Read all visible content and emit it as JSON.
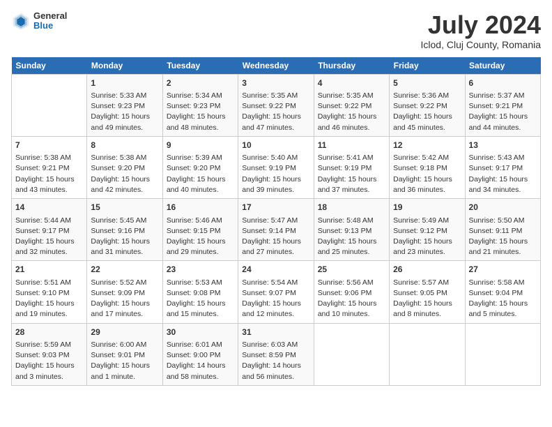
{
  "header": {
    "logo": {
      "general": "General",
      "blue": "Blue"
    },
    "title": "July 2024",
    "location": "Iclod, Cluj County, Romania"
  },
  "calendar": {
    "weekdays": [
      "Sunday",
      "Monday",
      "Tuesday",
      "Wednesday",
      "Thursday",
      "Friday",
      "Saturday"
    ],
    "weeks": [
      [
        {
          "day": "",
          "info": ""
        },
        {
          "day": "1",
          "info": "Sunrise: 5:33 AM\nSunset: 9:23 PM\nDaylight: 15 hours\nand 49 minutes."
        },
        {
          "day": "2",
          "info": "Sunrise: 5:34 AM\nSunset: 9:23 PM\nDaylight: 15 hours\nand 48 minutes."
        },
        {
          "day": "3",
          "info": "Sunrise: 5:35 AM\nSunset: 9:22 PM\nDaylight: 15 hours\nand 47 minutes."
        },
        {
          "day": "4",
          "info": "Sunrise: 5:35 AM\nSunset: 9:22 PM\nDaylight: 15 hours\nand 46 minutes."
        },
        {
          "day": "5",
          "info": "Sunrise: 5:36 AM\nSunset: 9:22 PM\nDaylight: 15 hours\nand 45 minutes."
        },
        {
          "day": "6",
          "info": "Sunrise: 5:37 AM\nSunset: 9:21 PM\nDaylight: 15 hours\nand 44 minutes."
        }
      ],
      [
        {
          "day": "7",
          "info": "Sunrise: 5:38 AM\nSunset: 9:21 PM\nDaylight: 15 hours\nand 43 minutes."
        },
        {
          "day": "8",
          "info": "Sunrise: 5:38 AM\nSunset: 9:20 PM\nDaylight: 15 hours\nand 42 minutes."
        },
        {
          "day": "9",
          "info": "Sunrise: 5:39 AM\nSunset: 9:20 PM\nDaylight: 15 hours\nand 40 minutes."
        },
        {
          "day": "10",
          "info": "Sunrise: 5:40 AM\nSunset: 9:19 PM\nDaylight: 15 hours\nand 39 minutes."
        },
        {
          "day": "11",
          "info": "Sunrise: 5:41 AM\nSunset: 9:19 PM\nDaylight: 15 hours\nand 37 minutes."
        },
        {
          "day": "12",
          "info": "Sunrise: 5:42 AM\nSunset: 9:18 PM\nDaylight: 15 hours\nand 36 minutes."
        },
        {
          "day": "13",
          "info": "Sunrise: 5:43 AM\nSunset: 9:17 PM\nDaylight: 15 hours\nand 34 minutes."
        }
      ],
      [
        {
          "day": "14",
          "info": "Sunrise: 5:44 AM\nSunset: 9:17 PM\nDaylight: 15 hours\nand 32 minutes."
        },
        {
          "day": "15",
          "info": "Sunrise: 5:45 AM\nSunset: 9:16 PM\nDaylight: 15 hours\nand 31 minutes."
        },
        {
          "day": "16",
          "info": "Sunrise: 5:46 AM\nSunset: 9:15 PM\nDaylight: 15 hours\nand 29 minutes."
        },
        {
          "day": "17",
          "info": "Sunrise: 5:47 AM\nSunset: 9:14 PM\nDaylight: 15 hours\nand 27 minutes."
        },
        {
          "day": "18",
          "info": "Sunrise: 5:48 AM\nSunset: 9:13 PM\nDaylight: 15 hours\nand 25 minutes."
        },
        {
          "day": "19",
          "info": "Sunrise: 5:49 AM\nSunset: 9:12 PM\nDaylight: 15 hours\nand 23 minutes."
        },
        {
          "day": "20",
          "info": "Sunrise: 5:50 AM\nSunset: 9:11 PM\nDaylight: 15 hours\nand 21 minutes."
        }
      ],
      [
        {
          "day": "21",
          "info": "Sunrise: 5:51 AM\nSunset: 9:10 PM\nDaylight: 15 hours\nand 19 minutes."
        },
        {
          "day": "22",
          "info": "Sunrise: 5:52 AM\nSunset: 9:09 PM\nDaylight: 15 hours\nand 17 minutes."
        },
        {
          "day": "23",
          "info": "Sunrise: 5:53 AM\nSunset: 9:08 PM\nDaylight: 15 hours\nand 15 minutes."
        },
        {
          "day": "24",
          "info": "Sunrise: 5:54 AM\nSunset: 9:07 PM\nDaylight: 15 hours\nand 12 minutes."
        },
        {
          "day": "25",
          "info": "Sunrise: 5:56 AM\nSunset: 9:06 PM\nDaylight: 15 hours\nand 10 minutes."
        },
        {
          "day": "26",
          "info": "Sunrise: 5:57 AM\nSunset: 9:05 PM\nDaylight: 15 hours\nand 8 minutes."
        },
        {
          "day": "27",
          "info": "Sunrise: 5:58 AM\nSunset: 9:04 PM\nDaylight: 15 hours\nand 5 minutes."
        }
      ],
      [
        {
          "day": "28",
          "info": "Sunrise: 5:59 AM\nSunset: 9:03 PM\nDaylight: 15 hours\nand 3 minutes."
        },
        {
          "day": "29",
          "info": "Sunrise: 6:00 AM\nSunset: 9:01 PM\nDaylight: 15 hours\nand 1 minute."
        },
        {
          "day": "30",
          "info": "Sunrise: 6:01 AM\nSunset: 9:00 PM\nDaylight: 14 hours\nand 58 minutes."
        },
        {
          "day": "31",
          "info": "Sunrise: 6:03 AM\nSunset: 8:59 PM\nDaylight: 14 hours\nand 56 minutes."
        },
        {
          "day": "",
          "info": ""
        },
        {
          "day": "",
          "info": ""
        },
        {
          "day": "",
          "info": ""
        }
      ]
    ]
  }
}
